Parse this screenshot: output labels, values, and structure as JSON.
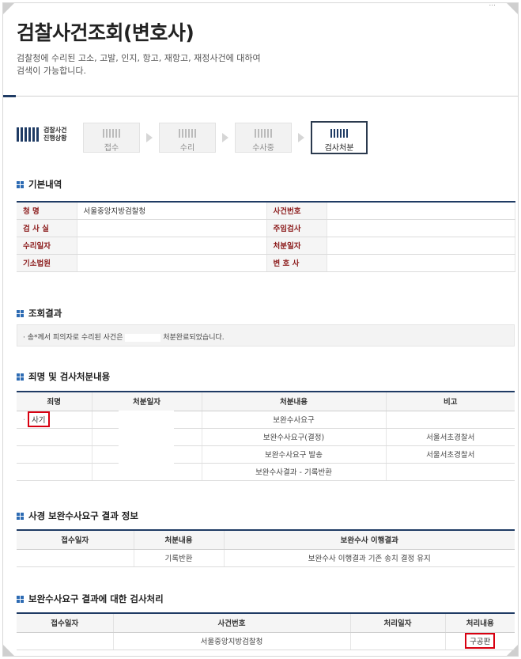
{
  "breadcrumb": "...",
  "page": {
    "title": "검찰사건조회(변호사)",
    "description": "검찰청에 수리된 고소, 고발, 인지, 항고, 재항고, 재정사건에 대하여 검색이 가능합니다."
  },
  "progress": {
    "label_line1": "검찰사건",
    "label_line2": "진행상황",
    "steps": [
      {
        "label": "접수",
        "active": false
      },
      {
        "label": "수리",
        "active": false
      },
      {
        "label": "수사중",
        "active": false
      },
      {
        "label": "검사처분",
        "active": true
      }
    ]
  },
  "basic": {
    "heading": "기본내역",
    "rows": [
      {
        "l1": "청    명",
        "v1": "서울중앙지방검찰청",
        "l2": "사건번호",
        "v2": ""
      },
      {
        "l1": "검 사 실",
        "v1": "",
        "l2": "주임검사",
        "v2": ""
      },
      {
        "l1": "수리일자",
        "v1": "",
        "l2": "처분일자",
        "v2": ""
      },
      {
        "l1": "기소법원",
        "v1": "",
        "l2": "변 호 사",
        "v2": ""
      }
    ]
  },
  "result": {
    "heading": "조회결과",
    "prefix": "송*께서 피의자로 수리된 사건은",
    "suffix": "처분완료되었습니다."
  },
  "crime": {
    "heading": "죄명 및 검사처분내용",
    "headers": [
      "죄명",
      "처분일자",
      "처분내용",
      "비고"
    ],
    "rows": [
      {
        "crime": "사기",
        "date": "",
        "content": "보완수사요구",
        "note": ""
      },
      {
        "crime": "",
        "date": "",
        "content": "보완수사요구(결정)",
        "note": "서울서초경찰서"
      },
      {
        "crime": "",
        "date": "",
        "content": "보완수사요구 발송",
        "note": "서울서초경찰서"
      },
      {
        "crime": "",
        "date": "",
        "content": "보완수사결과 - 기록반환",
        "note": ""
      }
    ]
  },
  "supp": {
    "heading": "사경 보완수사요구 결과 정보",
    "headers": [
      "접수일자",
      "처분내용",
      "보완수사 이행결과"
    ],
    "rows": [
      {
        "date": "",
        "content": "기록반환",
        "result": "보완수사 이행결과 기존 송치 결정 유지"
      }
    ]
  },
  "proc": {
    "heading": "보완수사요구 결과에 대한 검사처리",
    "headers": [
      "접수일자",
      "사건번호",
      "처리일자",
      "처리내용"
    ],
    "rows": [
      {
        "date": "",
        "case_no": "서울중앙지방검찰청",
        "proc_date": "",
        "content": "구공판"
      }
    ]
  },
  "colors": {
    "navy": "#1f3b64",
    "label_red": "#8b1a1a",
    "highlight": "#d80010",
    "section_icon": "#2d6bb3"
  }
}
